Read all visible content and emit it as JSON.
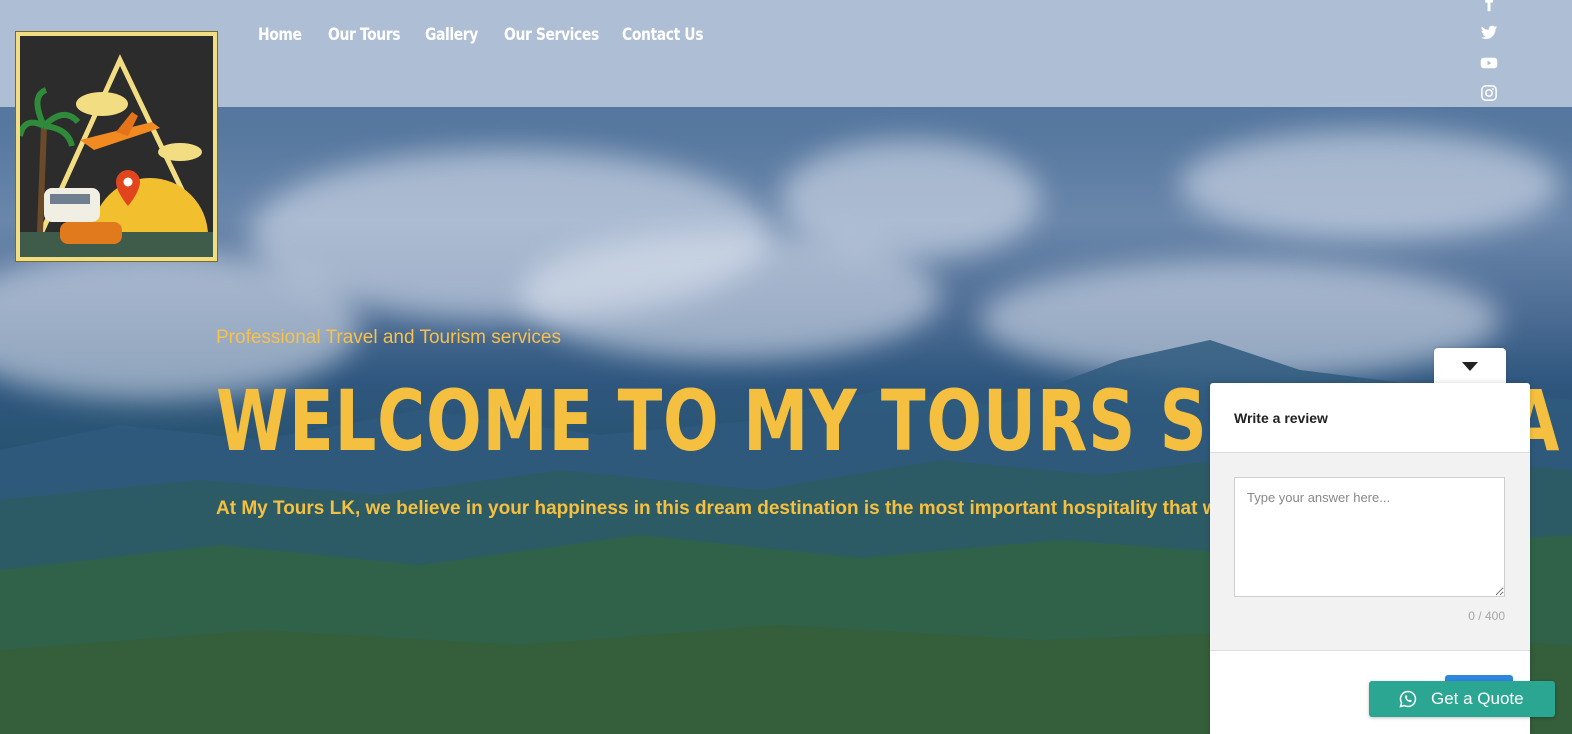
{
  "nav": {
    "items": [
      "Home",
      "Our Tours",
      "Gallery",
      "Our Services",
      "Contact Us"
    ]
  },
  "social": [
    "facebook-icon",
    "twitter-icon",
    "youtube-icon",
    "instagram-icon"
  ],
  "hero": {
    "tagline": "Professional Travel and Tourism services",
    "headline": "WELCOME TO MY TOURS SRI LANKA",
    "description": "At My Tours LK, we believe in your happiness in this dream destination is the most important hospitality that we"
  },
  "review": {
    "title": "Write a review",
    "placeholder": "Type your answer here...",
    "counter": "0 / 400"
  },
  "quote": {
    "label": "Get a Quote"
  },
  "colors": {
    "accent": "#f5c03f",
    "whatsapp": "#2aa693",
    "submit": "#2e86de"
  }
}
